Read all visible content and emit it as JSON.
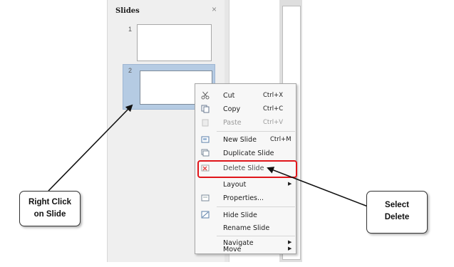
{
  "slides_pane": {
    "title": "Slides",
    "close_glyph": "×",
    "slides": [
      {
        "number": "1"
      },
      {
        "number": "2"
      }
    ]
  },
  "context_menu": {
    "cut": {
      "label": "Cut",
      "shortcut": "Ctrl+X",
      "icon": "scissors-icon"
    },
    "copy": {
      "label": "Copy",
      "shortcut": "Ctrl+C",
      "icon": "copy-icon"
    },
    "paste": {
      "label": "Paste",
      "shortcut": "Ctrl+V",
      "icon": "paste-icon"
    },
    "new_slide": {
      "label": "New Slide",
      "shortcut": "Ctrl+M",
      "icon": "new-slide-icon"
    },
    "duplicate_slide": {
      "label": "Duplicate Slide",
      "icon": "duplicate-slide-icon"
    },
    "delete_slide": {
      "label": "Delete Slide",
      "icon": "delete-slide-icon"
    },
    "layout": {
      "label": "Layout",
      "arrow": "▶"
    },
    "properties": {
      "label": "Properties...",
      "icon": "properties-icon"
    },
    "hide_slide": {
      "label": "Hide Slide",
      "icon": "hide-slide-icon"
    },
    "rename_slide": {
      "label": "Rename Slide"
    },
    "navigate": {
      "label": "Navigate",
      "arrow": "▶"
    },
    "move": {
      "label": "Move",
      "arrow": "▶"
    }
  },
  "callouts": {
    "left": {
      "line1": "Right Click",
      "line2": "on Slide"
    },
    "right": {
      "line1": "Select",
      "line2": "Delete"
    }
  },
  "colors": {
    "highlight": "#e0151a",
    "selected_slide": "#b5cbe3"
  }
}
